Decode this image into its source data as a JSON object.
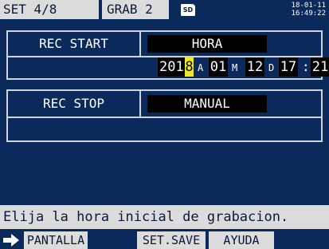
{
  "header": {
    "set_label": "SET  4/8",
    "grab_label": "GRAB 2",
    "sd_label": "SD",
    "date": "18-01-11",
    "time": "16:49:22"
  },
  "rec_start": {
    "label": "REC START",
    "mode": "HORA",
    "year_prefix": "201",
    "year_digit_highlight": "8",
    "year_unit": "A",
    "month": "01",
    "month_unit": "M",
    "day": "12",
    "day_unit": "D",
    "hour": "17",
    "colon": ":",
    "minute": "21"
  },
  "rec_stop": {
    "label": "REC STOP",
    "mode": "MANUAL"
  },
  "status_message": "Elija la hora inicial de grabacion.",
  "softkeys": {
    "key1": "PANTALLA",
    "key2": "",
    "key3": "SET.SAVE",
    "key4": "AYUDA"
  },
  "colors": {
    "background": "#0b2a5c",
    "highlight": "#f1ea1f",
    "panel_border": "#cfd4dc"
  }
}
